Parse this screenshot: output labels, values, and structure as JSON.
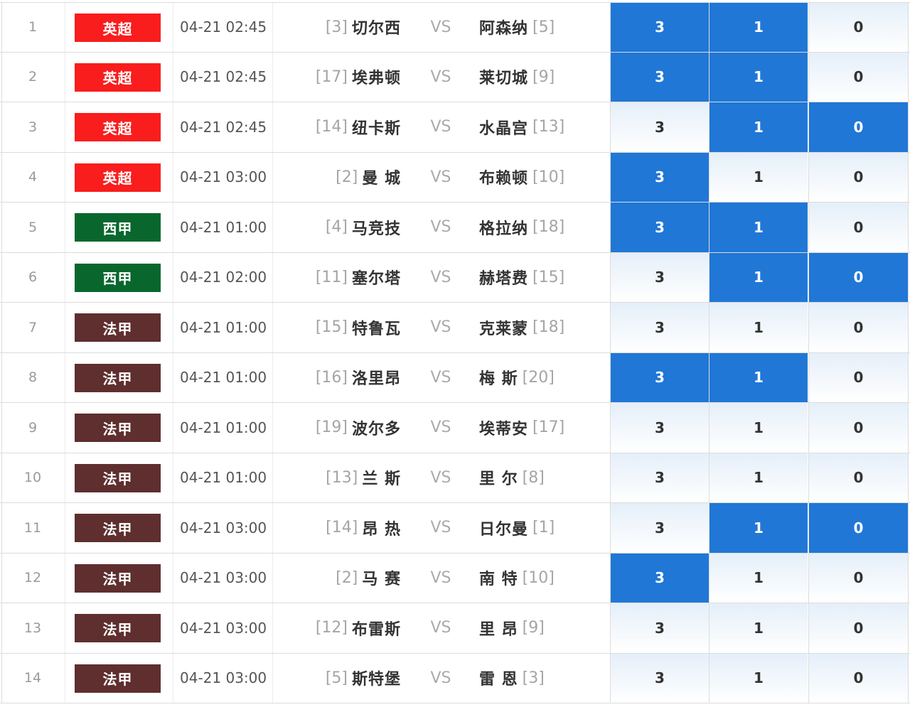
{
  "colors": {
    "league_premier": "#f91d1d",
    "league_laliga": "#09672d",
    "league_ligue1": "#5f2e2e",
    "selected_cell": "#2077d6"
  },
  "outcome_labels": [
    "3",
    "1",
    "0"
  ],
  "matches": [
    {
      "no": "1",
      "league": "英超",
      "league_key": "premier",
      "time": "04-21 02:45",
      "home_rank": "[3]",
      "home": "切尔西",
      "vs": "VS",
      "away": "阿森纳",
      "away_rank": "[5]",
      "selected": [
        true,
        true,
        false
      ]
    },
    {
      "no": "2",
      "league": "英超",
      "league_key": "premier",
      "time": "04-21 02:45",
      "home_rank": "[17]",
      "home": "埃弗顿",
      "vs": "VS",
      "away": "莱切城",
      "away_rank": "[9]",
      "selected": [
        true,
        true,
        false
      ]
    },
    {
      "no": "3",
      "league": "英超",
      "league_key": "premier",
      "time": "04-21 02:45",
      "home_rank": "[14]",
      "home": "纽卡斯",
      "vs": "VS",
      "away": "水晶宫",
      "away_rank": "[13]",
      "selected": [
        false,
        true,
        true
      ]
    },
    {
      "no": "4",
      "league": "英超",
      "league_key": "premier",
      "time": "04-21 03:00",
      "home_rank": "[2]",
      "home": "曼 城",
      "vs": "VS",
      "away": "布赖顿",
      "away_rank": "[10]",
      "selected": [
        true,
        false,
        false
      ]
    },
    {
      "no": "5",
      "league": "西甲",
      "league_key": "laliga",
      "time": "04-21 01:00",
      "home_rank": "[4]",
      "home": "马竞技",
      "vs": "VS",
      "away": "格拉纳",
      "away_rank": "[18]",
      "selected": [
        true,
        true,
        false
      ]
    },
    {
      "no": "6",
      "league": "西甲",
      "league_key": "laliga",
      "time": "04-21 02:00",
      "home_rank": "[11]",
      "home": "塞尔塔",
      "vs": "VS",
      "away": "赫塔费",
      "away_rank": "[15]",
      "selected": [
        false,
        true,
        true
      ]
    },
    {
      "no": "7",
      "league": "法甲",
      "league_key": "ligue1",
      "time": "04-21 01:00",
      "home_rank": "[15]",
      "home": "特鲁瓦",
      "vs": "VS",
      "away": "克莱蒙",
      "away_rank": "[18]",
      "selected": [
        false,
        false,
        false
      ]
    },
    {
      "no": "8",
      "league": "法甲",
      "league_key": "ligue1",
      "time": "04-21 01:00",
      "home_rank": "[16]",
      "home": "洛里昂",
      "vs": "VS",
      "away": "梅 斯",
      "away_rank": "[20]",
      "selected": [
        true,
        true,
        false
      ]
    },
    {
      "no": "9",
      "league": "法甲",
      "league_key": "ligue1",
      "time": "04-21 01:00",
      "home_rank": "[19]",
      "home": "波尔多",
      "vs": "VS",
      "away": "埃蒂安",
      "away_rank": "[17]",
      "selected": [
        false,
        false,
        false
      ]
    },
    {
      "no": "10",
      "league": "法甲",
      "league_key": "ligue1",
      "time": "04-21 01:00",
      "home_rank": "[13]",
      "home": "兰 斯",
      "vs": "VS",
      "away": "里 尔",
      "away_rank": "[8]",
      "selected": [
        false,
        false,
        false
      ]
    },
    {
      "no": "11",
      "league": "法甲",
      "league_key": "ligue1",
      "time": "04-21 03:00",
      "home_rank": "[14]",
      "home": "昂 热",
      "vs": "VS",
      "away": "日尔曼",
      "away_rank": "[1]",
      "selected": [
        false,
        true,
        true
      ]
    },
    {
      "no": "12",
      "league": "法甲",
      "league_key": "ligue1",
      "time": "04-21 03:00",
      "home_rank": "[2]",
      "home": "马 赛",
      "vs": "VS",
      "away": "南 特",
      "away_rank": "[10]",
      "selected": [
        true,
        false,
        false
      ]
    },
    {
      "no": "13",
      "league": "法甲",
      "league_key": "ligue1",
      "time": "04-21 03:00",
      "home_rank": "[12]",
      "home": "布雷斯",
      "vs": "VS",
      "away": "里 昂",
      "away_rank": "[9]",
      "selected": [
        false,
        false,
        false
      ]
    },
    {
      "no": "14",
      "league": "法甲",
      "league_key": "ligue1",
      "time": "04-21 03:00",
      "home_rank": "[5]",
      "home": "斯特堡",
      "vs": "VS",
      "away": "雷 恩",
      "away_rank": "[3]",
      "selected": [
        false,
        false,
        false
      ]
    }
  ]
}
